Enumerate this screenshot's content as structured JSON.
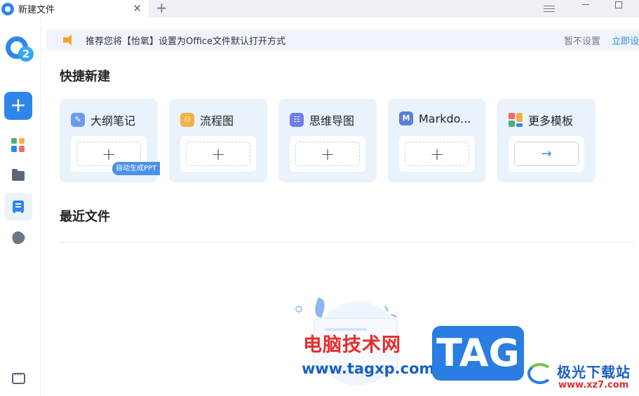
{
  "tab": {
    "title": "新建文件",
    "close": "✕",
    "add": "+"
  },
  "banner": {
    "text": "推荐您将【怡氧】设置为Office文件默认打开方式",
    "skip": "暂不设置",
    "set_now": "立即设置"
  },
  "sidebar": {
    "new_button": "+",
    "items": [
      {
        "name": "apps",
        "icon": "apps-grid-icon",
        "active": false
      },
      {
        "name": "folder",
        "icon": "folder-icon",
        "active": false
      },
      {
        "name": "documents",
        "icon": "document-icon",
        "active": true
      },
      {
        "name": "acorn",
        "icon": "acorn-icon",
        "active": false
      }
    ],
    "feedback_icon": "chat-icon",
    "logo_digit": "2"
  },
  "quick_create": {
    "title": "快捷新建",
    "cards": [
      {
        "label": "大纲笔记",
        "icon": "outline-note-icon",
        "icon_color": "#6b9bef",
        "icon_glyph": "✎",
        "action": "+",
        "badge": "自动生成PPT"
      },
      {
        "label": "流程图",
        "icon": "flowchart-icon",
        "icon_color": "#f5b04a",
        "icon_glyph": "⚇",
        "action": "+"
      },
      {
        "label": "思维导图",
        "icon": "mindmap-icon",
        "icon_color": "#6f7fe8",
        "icon_glyph": "☷",
        "action": "+"
      },
      {
        "label": "Markdo...",
        "icon": "markdown-icon",
        "icon_color": "#5c7fd8",
        "icon_glyph": "M",
        "action": "+"
      },
      {
        "label": "更多模板",
        "icon": "more-templates-icon",
        "icon_color": "#f26b5b",
        "icon_glyph": "",
        "action": "→"
      }
    ]
  },
  "recent": {
    "title": "最近文件"
  },
  "watermark": {
    "site_cn": "电脑技术网",
    "site_url": "www.tagxp.com",
    "tag": "TAG",
    "site2_name": "极光下载站",
    "site2_url": "www.xz7.com"
  }
}
